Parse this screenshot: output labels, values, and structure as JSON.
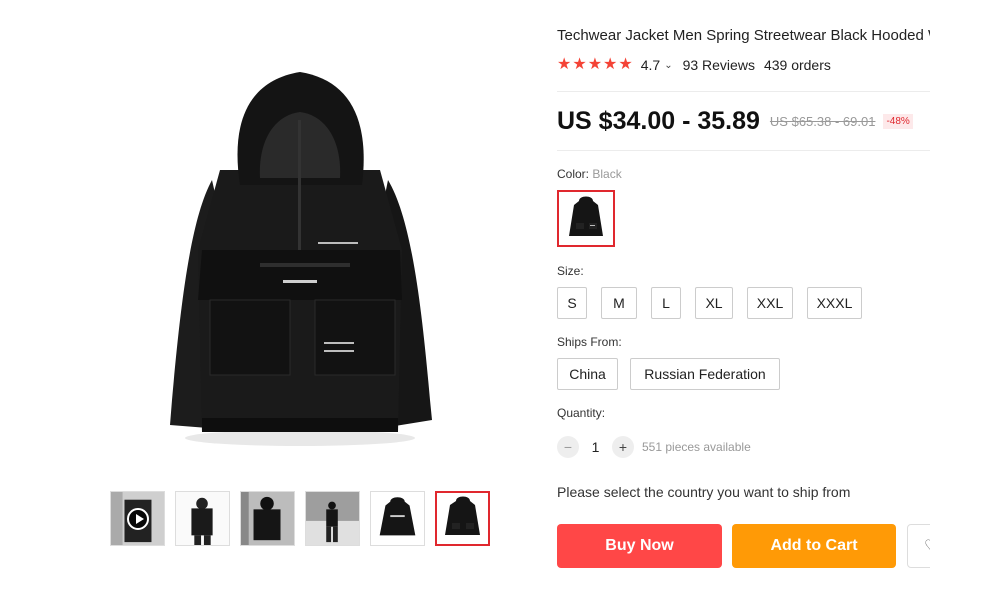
{
  "product": {
    "title": "Techwear Jacket Men Spring Streetwear Black Hooded Waterproof Jacket",
    "rating": "4.7",
    "reviews": "93 Reviews",
    "orders": "439 orders",
    "star_count": 5
  },
  "price": {
    "current": "US $34.00 - 35.89",
    "original": "US $65.38 - 69.01",
    "discount": "-48%"
  },
  "color": {
    "label": "Color: ",
    "selected": "Black"
  },
  "size": {
    "label": "Size:",
    "options": [
      "S",
      "M",
      "L",
      "XL",
      "XXL",
      "XXXL"
    ]
  },
  "ships_from": {
    "label": "Ships From:",
    "options": [
      "China",
      "Russian Federation"
    ]
  },
  "quantity": {
    "label": "Quantity:",
    "minus": "−",
    "plus": "+",
    "value": "1",
    "available": "551 pieces available"
  },
  "ship_note": "Please select the country you want to ship from",
  "actions": {
    "buy_now": "Buy Now",
    "add_to_cart": "Add to Cart",
    "wishlist": "♡"
  },
  "gallery": {
    "thumbnails": [
      "video-thumbnail",
      "model-front",
      "model-pocket",
      "model-full-body",
      "jacket-back",
      "jacket-front"
    ],
    "selected_index": 5
  },
  "colors": {
    "accent": "#ff4747",
    "cart": "#ff9a06",
    "selected_border": "#e0282e"
  }
}
